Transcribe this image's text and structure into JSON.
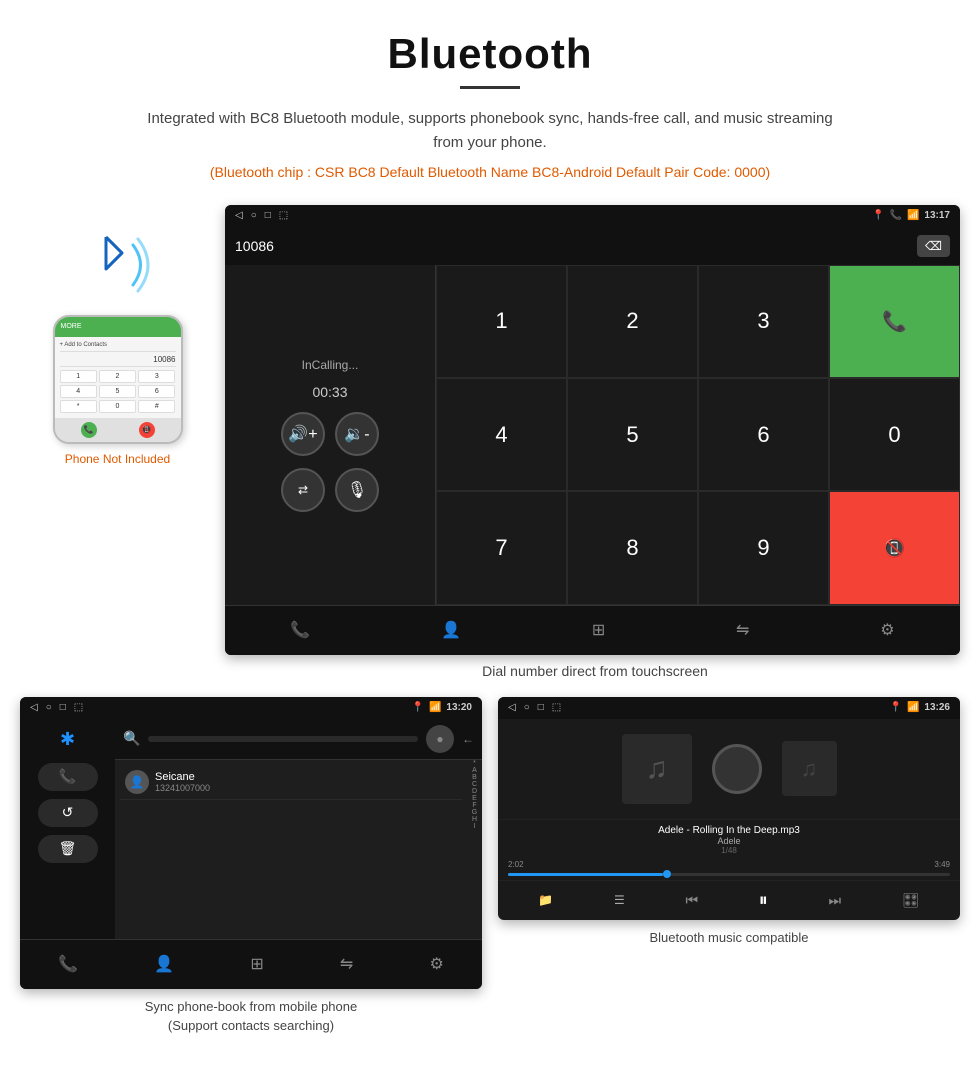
{
  "header": {
    "title": "Bluetooth",
    "description": "Integrated with BC8 Bluetooth module, supports phonebook sync, hands-free call, and music streaming from your phone.",
    "specs": "(Bluetooth chip : CSR BC8    Default Bluetooth Name BC8-Android    Default Pair Code: 0000)"
  },
  "top_screen": {
    "status_bar": {
      "time": "13:17",
      "nav_icons": [
        "◁",
        "○",
        "□"
      ]
    },
    "dial_number": "10086",
    "dial_status": "InCalling...",
    "dial_timer": "00:33",
    "keypad": [
      "1",
      "2",
      "3",
      "*",
      "4",
      "5",
      "6",
      "0",
      "7",
      "8",
      "9",
      "#"
    ]
  },
  "top_caption": "Dial number direct from touchscreen",
  "phone_label": "Phone Not Included",
  "phonebook_screen": {
    "status_bar": {
      "time": "13:20"
    },
    "contact": {
      "name": "Seicane",
      "number": "13241007000"
    },
    "alphabet": [
      "*",
      "A",
      "B",
      "C",
      "D",
      "E",
      "F",
      "G",
      "H",
      "I"
    ]
  },
  "phonebook_caption_line1": "Sync phone-book from mobile phone",
  "phonebook_caption_line2": "(Support contacts searching)",
  "music_screen": {
    "status_bar": {
      "time": "13:26"
    },
    "song": "Adele - Rolling In the Deep.mp3",
    "artist": "Adele",
    "track": "1/48",
    "current_time": "2:02",
    "total_time": "3:49"
  },
  "music_caption": "Bluetooth music compatible"
}
